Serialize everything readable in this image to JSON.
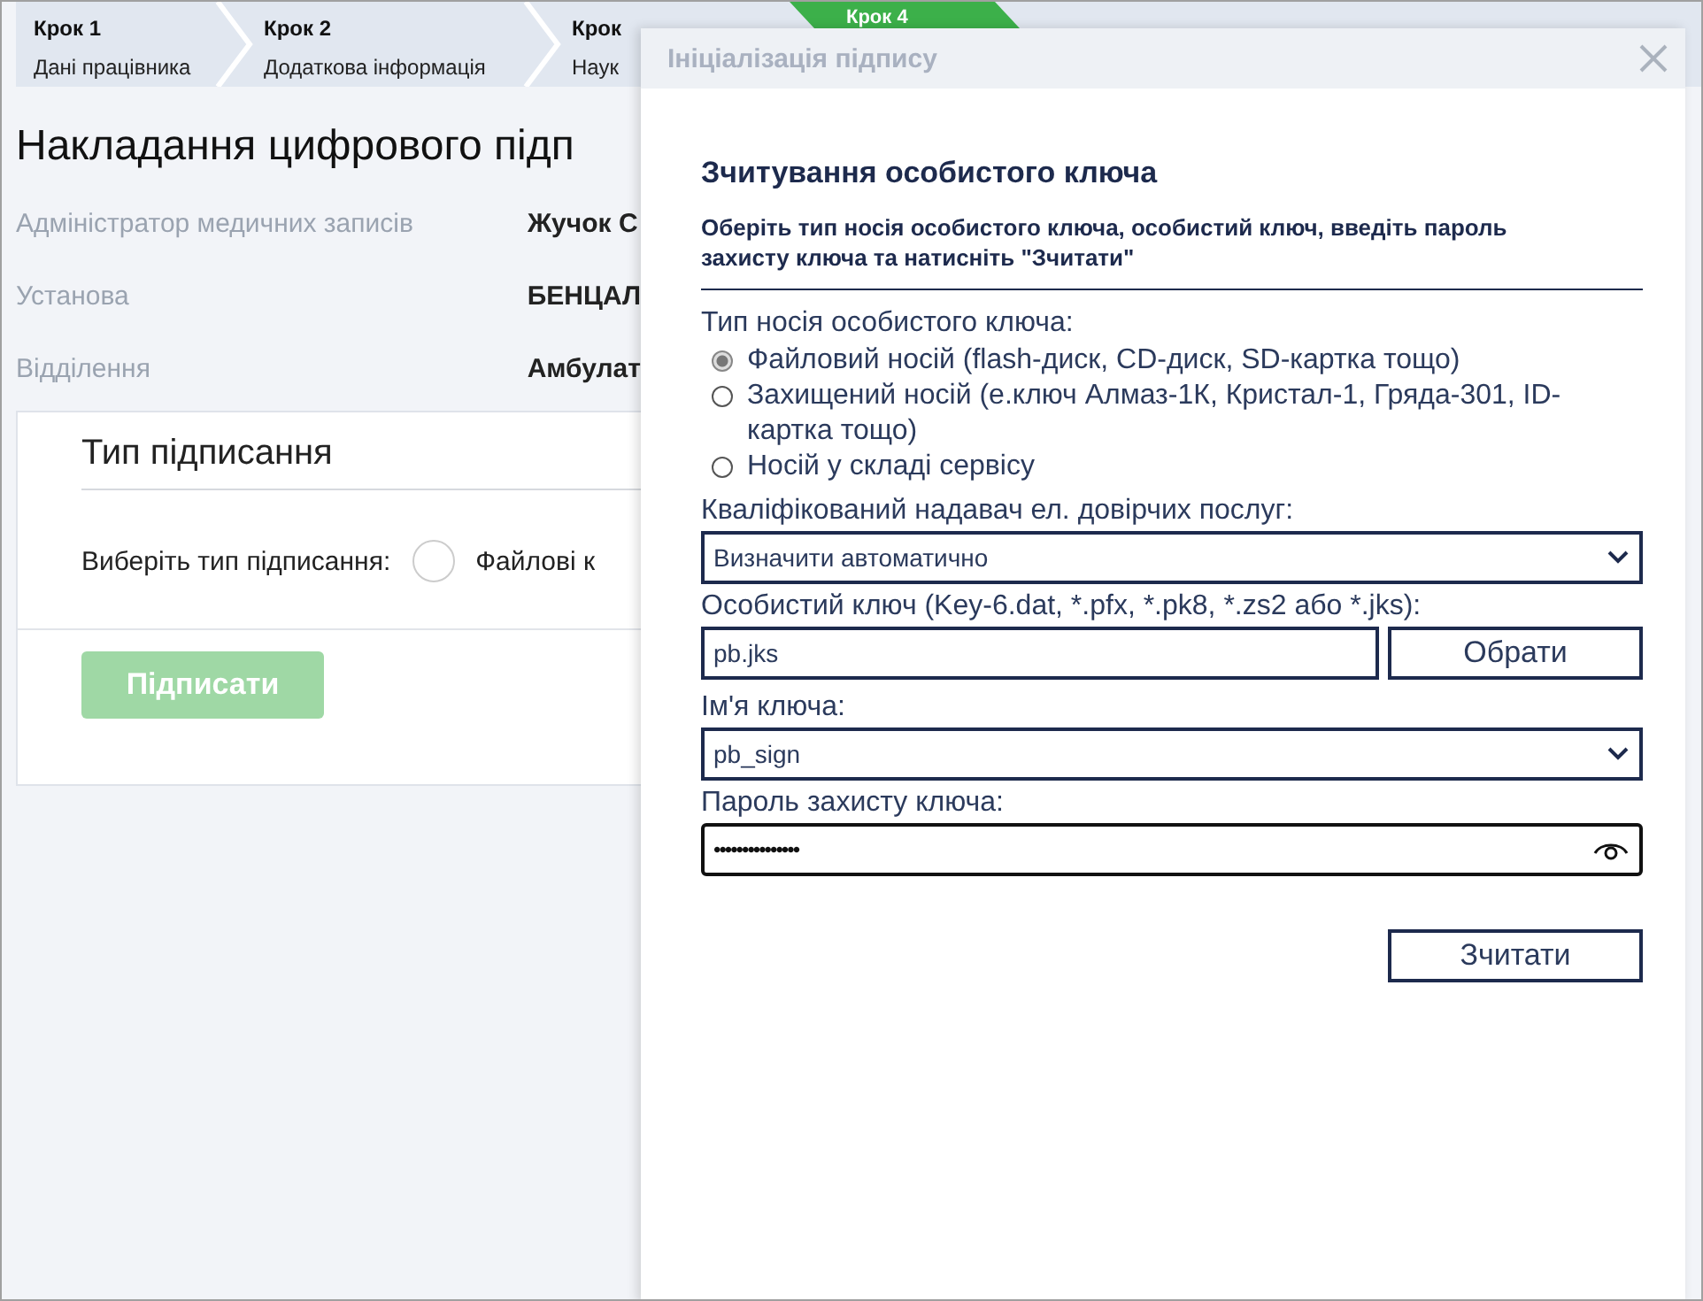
{
  "steps": [
    {
      "title": "Крок 1",
      "subtitle": "Дані працівника",
      "selected": false
    },
    {
      "title": "Крок 2",
      "subtitle": "Додаткова інформація",
      "selected": false
    },
    {
      "title": "Крок",
      "subtitle": "Наук",
      "selected": false
    },
    {
      "title": "Крок 4",
      "selected": true
    }
  ],
  "page": {
    "title": "Накладання цифрового підп",
    "details": [
      {
        "label": "Адміністратор медичних записів",
        "value": "Жучок С"
      },
      {
        "label": "Установа",
        "value": "БЕНЦАЛ"
      },
      {
        "label": "Відділення",
        "value": "Амбулат"
      }
    ],
    "signing_card": {
      "title": "Тип підписання",
      "prompt": "Виберіть тип підписання:",
      "option": {
        "label": "Файлові к",
        "selected": false
      },
      "sign_button": {
        "label": "Підписати",
        "disabled": true
      }
    }
  },
  "dialog": {
    "title": "Ініціалізація підпису",
    "heading": "Зчитування особистого ключа",
    "instructions": "Оберіть тип носія особистого ключа, особистий ключ, введіть пароль захисту ключа та натисніть \"Зчитати\"",
    "media_label": "Тип носія особистого ключа:",
    "media_options": [
      {
        "label": "Файловий носій (flash-диск, CD-диск, SD-картка тощо)",
        "selected": true
      },
      {
        "label": "Захищений носій (е.ключ Алмаз-1К, Кристал-1, Гряда-301, ID-картка тощо)",
        "selected": false
      },
      {
        "label": "Носій у складі сервісу",
        "selected": false
      }
    ],
    "provider": {
      "label": "Кваліфікований надавач ел. довірчих послуг:",
      "value": "Визначити автоматично"
    },
    "key_file": {
      "label": "Особистий ключ (Key-6.dat, *.pfx, *.pk8, *.zs2 або *.jks):",
      "value": "pb.jks",
      "button": "Обрати"
    },
    "key_name": {
      "label": "Ім'я ключа:",
      "value": "pb_sign"
    },
    "password": {
      "label": "Пароль захисту ключа:",
      "value": "•••••••••••••••"
    },
    "read_button": "Зчитати"
  }
}
